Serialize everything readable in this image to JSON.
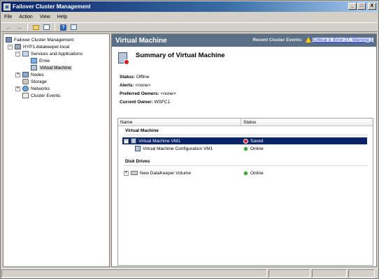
{
  "window": {
    "title": "Failover Cluster Management"
  },
  "window_buttons": {
    "minimize": "_",
    "maximize": "□",
    "close": "X"
  },
  "menu": [
    "File",
    "Action",
    "View",
    "Help"
  ],
  "tree": {
    "items": [
      {
        "label": "Failover Cluster Management",
        "icon": "cluster-icon",
        "expander": ""
      },
      {
        "label": "HYP1.datakeeper.local",
        "icon": "server-icon",
        "expander": "−"
      },
      {
        "label": "Services and Applications",
        "icon": "services-icon",
        "expander": "−"
      },
      {
        "label": "Ernie",
        "icon": "application-icon",
        "expander": ""
      },
      {
        "label": "Virtual Machine",
        "icon": "virtual-machine-icon",
        "expander": "",
        "selected": true
      },
      {
        "label": "Nodes",
        "icon": "nodes-icon",
        "expander": "+"
      },
      {
        "label": "Storage",
        "icon": "storage-icon",
        "expander": ""
      },
      {
        "label": "Networks",
        "icon": "networks-icon",
        "expander": "+"
      },
      {
        "label": "Cluster Events",
        "icon": "cluster-events-icon",
        "expander": ""
      }
    ]
  },
  "header": {
    "title": "Virtual Machine",
    "events_label": "Recent Cluster Events:",
    "events_link": "Critical 3, Error 27, Warning 1"
  },
  "summary": {
    "title": "Summary of Virtual Machine",
    "status_label": "Status:",
    "status_value": "Offline",
    "alerts_label": "Alerts:",
    "alerts_value": "<none>",
    "preferred_label": "Preferred Owners:",
    "preferred_value": "<none>",
    "owner_label": "Current Owner:",
    "owner_value": "WSFC1"
  },
  "grid": {
    "col_name": "Name",
    "col_status": "Status",
    "group_vm": "Virtual Machine",
    "group_disk": "Disk Drives",
    "vm_row": {
      "expander": "−",
      "name": "Virtual Machine VM1",
      "status": "Saved"
    },
    "vm_config_row": {
      "name": "Virtual Machine Configuration VM1",
      "status": "Online"
    },
    "disk_row": {
      "expander": "+",
      "name": "New DataKeeper Volume",
      "status": "Online"
    }
  },
  "colors": {
    "header_bg": "#5b6f86",
    "selection": "#0a246a",
    "status_saved": "#d42020",
    "status_online": "#3fa33f"
  }
}
